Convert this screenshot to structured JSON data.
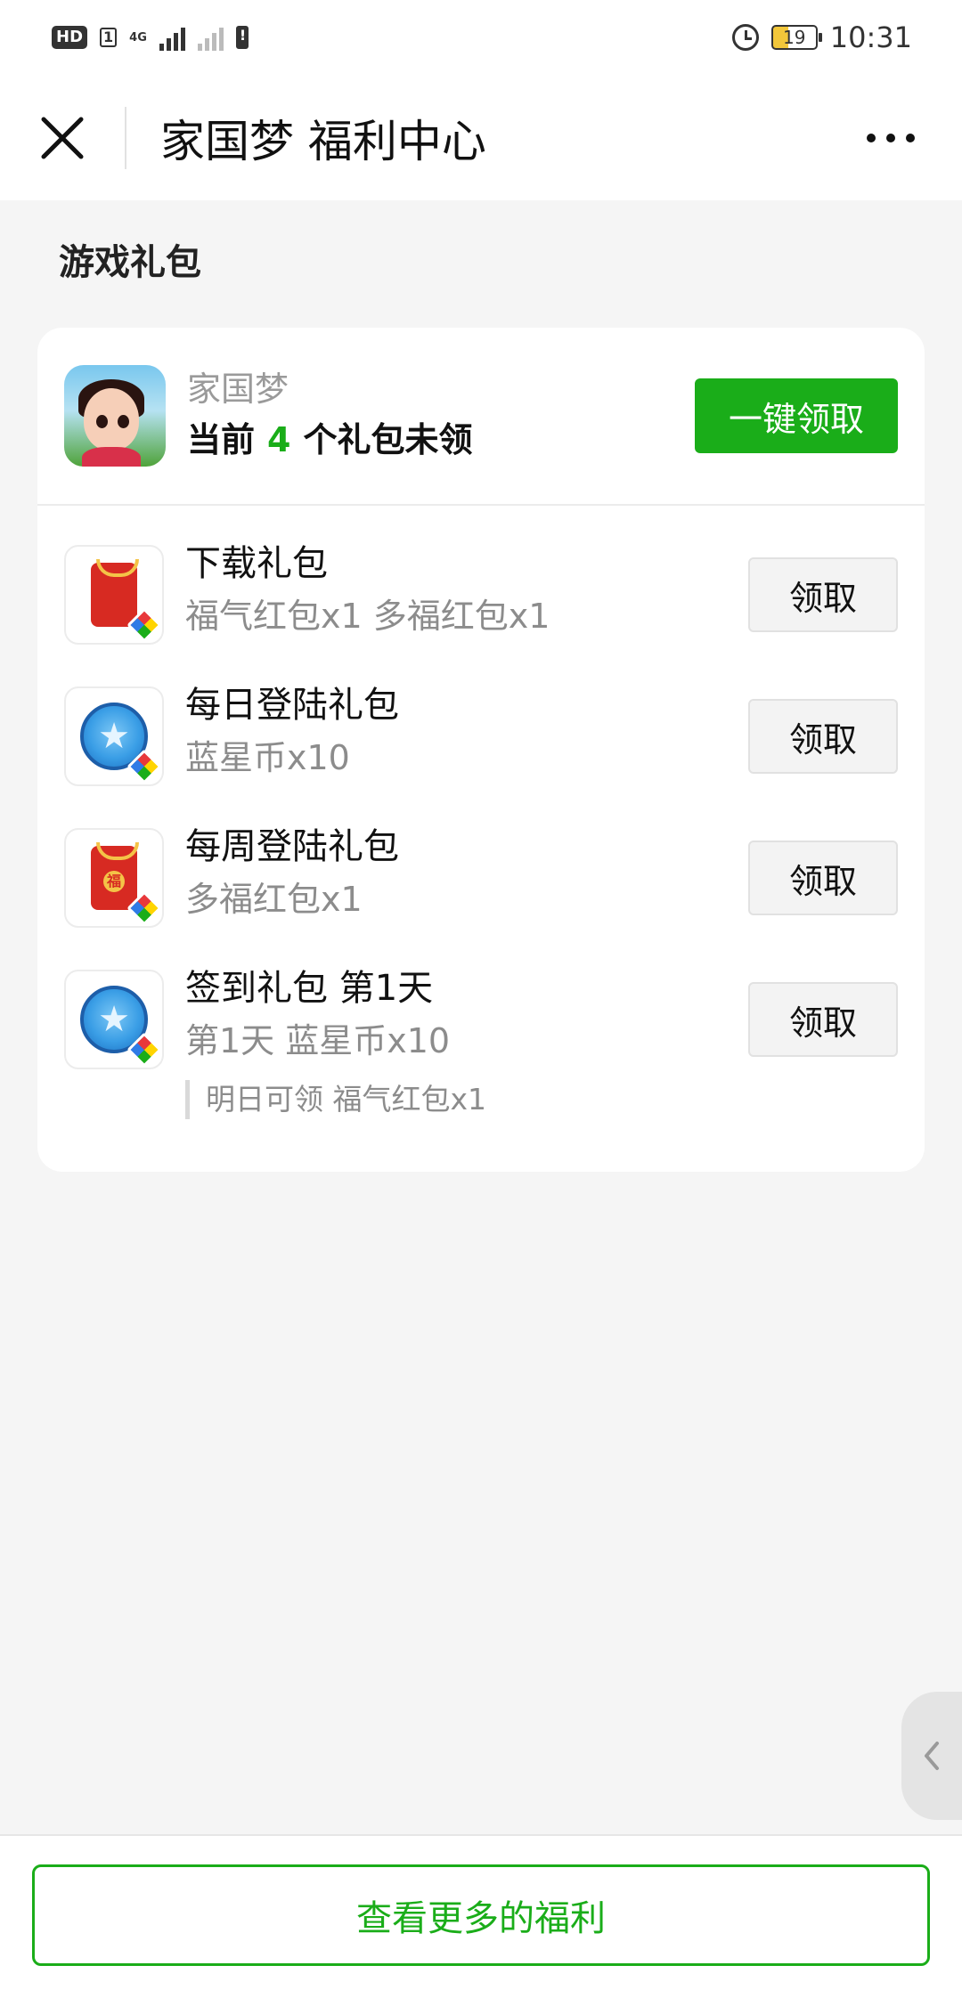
{
  "status_bar": {
    "hd_label": "HD",
    "sim_label": "1",
    "network_label": "4G",
    "battery_level": "19",
    "time": "10:31"
  },
  "titlebar": {
    "title": "家国梦 福利中心"
  },
  "section": {
    "title": "游戏礼包"
  },
  "card": {
    "game_name": "家国梦",
    "count_prefix": "当前",
    "count_value": "4",
    "count_suffix": "个礼包未领",
    "claim_all_label": "一键领取"
  },
  "gifts": [
    {
      "icon": "red-envelope-icon",
      "name": "下载礼包",
      "desc": "福气红包x1 多福红包x1",
      "claim_label": "领取"
    },
    {
      "icon": "blue-star-coin-icon",
      "name": "每日登陆礼包",
      "desc": "蓝星币x10",
      "claim_label": "领取"
    },
    {
      "icon": "fortune-red-envelope-icon",
      "name": "每周登陆礼包",
      "desc": "多福红包x1",
      "claim_label": "领取"
    },
    {
      "icon": "blue-star-coin-icon",
      "name": "签到礼包 第1天",
      "desc": "第1天 蓝星币x10",
      "note": "明日可领 福气红包x1",
      "claim_label": "领取"
    }
  ],
  "bottom": {
    "more_benefits_label": "查看更多的福利"
  },
  "colors": {
    "accent_green": "#1aad19",
    "background": "#f5f5f5"
  }
}
